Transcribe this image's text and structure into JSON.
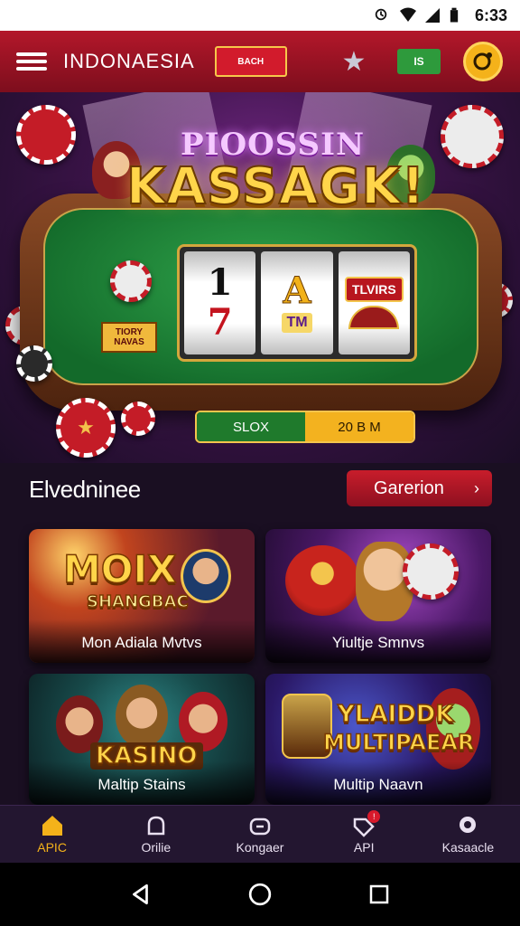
{
  "status_bar": {
    "time": "6:33"
  },
  "app_bar": {
    "title": "INDONAESIA",
    "flag_badge_text": "BACH",
    "chip_badge_text": "IS"
  },
  "hero": {
    "title_top": "PIOOSSIN",
    "title": "KASSAGK!",
    "felt_card_text": "TIORY NAVAS",
    "reels": [
      {
        "top": "1",
        "bottom": "7"
      },
      {
        "top": "A",
        "bottom": "TM"
      },
      {
        "top": "TLVIRS",
        "bottom": ""
      }
    ],
    "toggle_left": "SLOX",
    "toggle_right": "20 B M"
  },
  "section": {
    "title": "Elvedninee",
    "button_label": "Garerion",
    "button_icon": "chevron-right-icon"
  },
  "cards": [
    {
      "logo_line1": "MOIX",
      "logo_line2": "SHANGBAC",
      "caption": "Mon Adiala Mvtvs"
    },
    {
      "logo_line1": "",
      "logo_line2": "",
      "caption": "Yiultje Smnvs"
    },
    {
      "logo_line1": "KASINO",
      "logo_line2": "",
      "caption": "Maltip Stains"
    },
    {
      "logo_line1": "YLAIDDK",
      "logo_line2": "MULTIPAEAR",
      "caption": "Multip Naavn"
    }
  ],
  "bottom_nav": [
    {
      "label": "APIC",
      "icon": "home-icon",
      "active": true
    },
    {
      "label": "Orilie",
      "icon": "bell-icon",
      "active": false
    },
    {
      "label": "Kongaer",
      "icon": "controller-icon",
      "active": false
    },
    {
      "label": "API",
      "icon": "tag-icon",
      "active": false,
      "badge": "!"
    },
    {
      "label": "Kasaacle",
      "icon": "profile-icon",
      "active": false
    }
  ],
  "colors": {
    "app_bar": "#b3172a",
    "accent_gold": "#f4b21a",
    "felt_green": "#2fa34a",
    "background": "#1a0f22"
  }
}
